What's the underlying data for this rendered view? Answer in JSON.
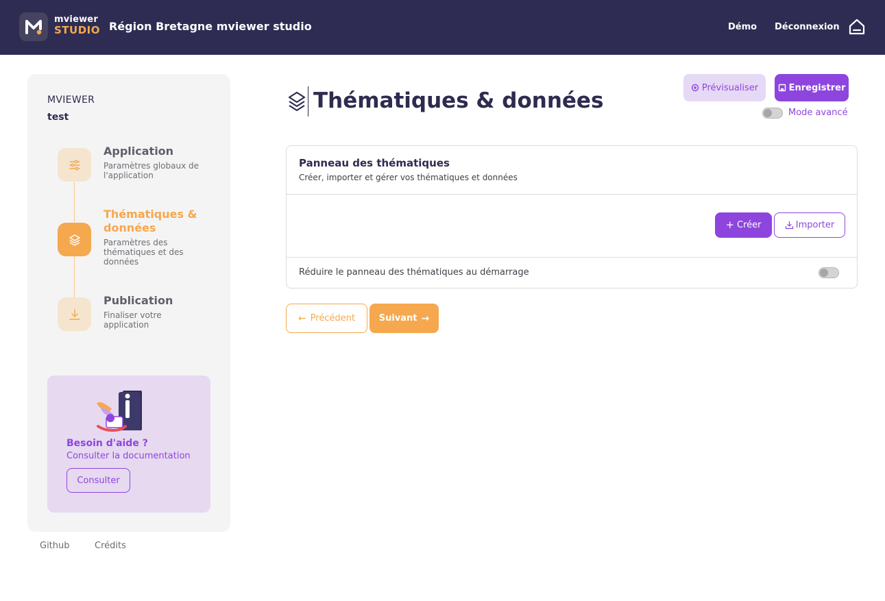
{
  "header": {
    "logo_line1": "mviewer",
    "logo_line2": "STUDIO",
    "app_title": "Région Bretagne mviewer studio",
    "nav": {
      "demo": "Démo",
      "logout": "Déconnexion"
    },
    "icons": {
      "logo": "mviewer-logo-icon",
      "home": "home-icon"
    }
  },
  "sidebar": {
    "title": "MVIEWER",
    "subtitle": "test",
    "steps": [
      {
        "label": "Application",
        "description": "Paramètres globaux de l'application",
        "icon": "sliders-icon",
        "active": false
      },
      {
        "label": "Thématiques & données",
        "description": "Paramètres des thématiques et des données",
        "icon": "layers-icon",
        "active": true
      },
      {
        "label": "Publication",
        "description": "Finaliser votre application",
        "icon": "download-icon",
        "active": false
      }
    ],
    "help": {
      "title": "Besoin d'aide ?",
      "link": "Consulter la documentation",
      "button": "Consulter"
    },
    "footer": {
      "github": "Github",
      "credits": "Crédits"
    }
  },
  "main": {
    "title": "Thématiques & données",
    "toolbar": {
      "preview": "Prévisualiser",
      "save": "Enregistrer",
      "advanced_mode": "Mode avancé",
      "advanced_mode_on": false
    },
    "panel": {
      "title": "Panneau des thématiques",
      "subtitle": "Créer, importer et gérer vos thématiques et données",
      "create": "Créer",
      "import": "Importer",
      "reduce_label": "Réduire le panneau des thématiques au démarrage",
      "reduce_on": false
    },
    "nav": {
      "previous": "Précédent",
      "next": "Suivant"
    }
  },
  "colors": {
    "header_bg": "#2e2c52",
    "accent_orange": "#f5a84d",
    "accent_purple": "#8e45de",
    "sidebar_bg": "#f4f4f4",
    "help_bg": "#e6d9f0"
  }
}
